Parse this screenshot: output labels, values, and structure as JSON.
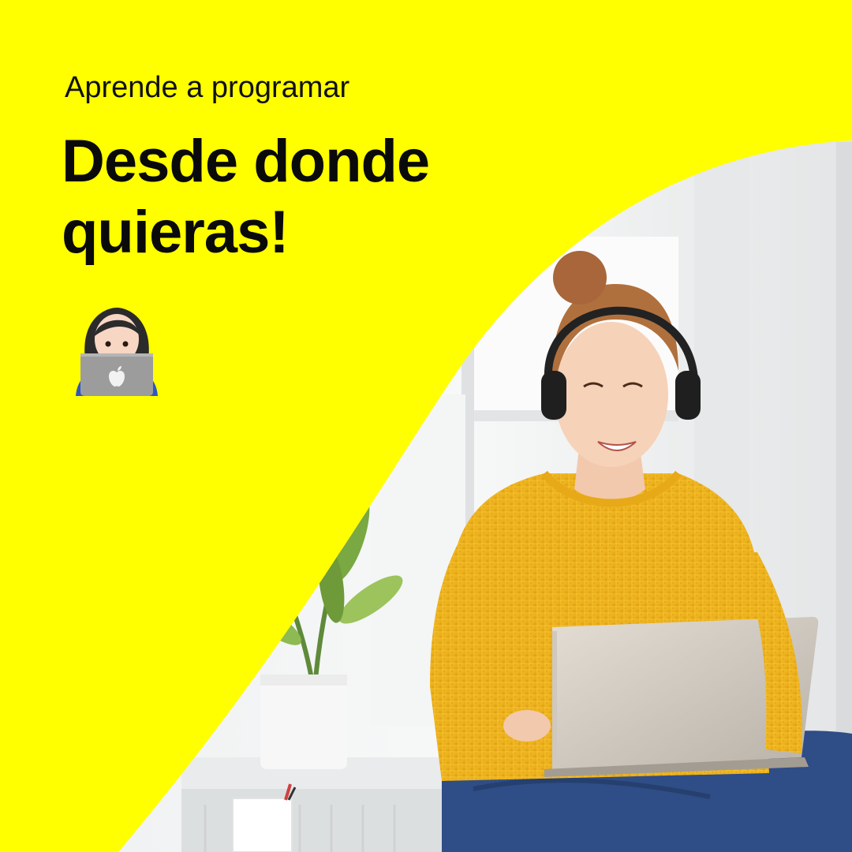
{
  "promo": {
    "eyebrow": "Aprende a programar",
    "headline_line1": "Desde donde",
    "headline_line2": "quieras!"
  },
  "icons": {
    "emoji": "woman-technologist-icon",
    "logo_on_laptop": "apple-logo-icon"
  },
  "colors": {
    "background_yellow": "#ffff00",
    "headline_text": "#0a0a0a",
    "sweater": "#f2b81f",
    "jeans": "#2f4d86"
  }
}
